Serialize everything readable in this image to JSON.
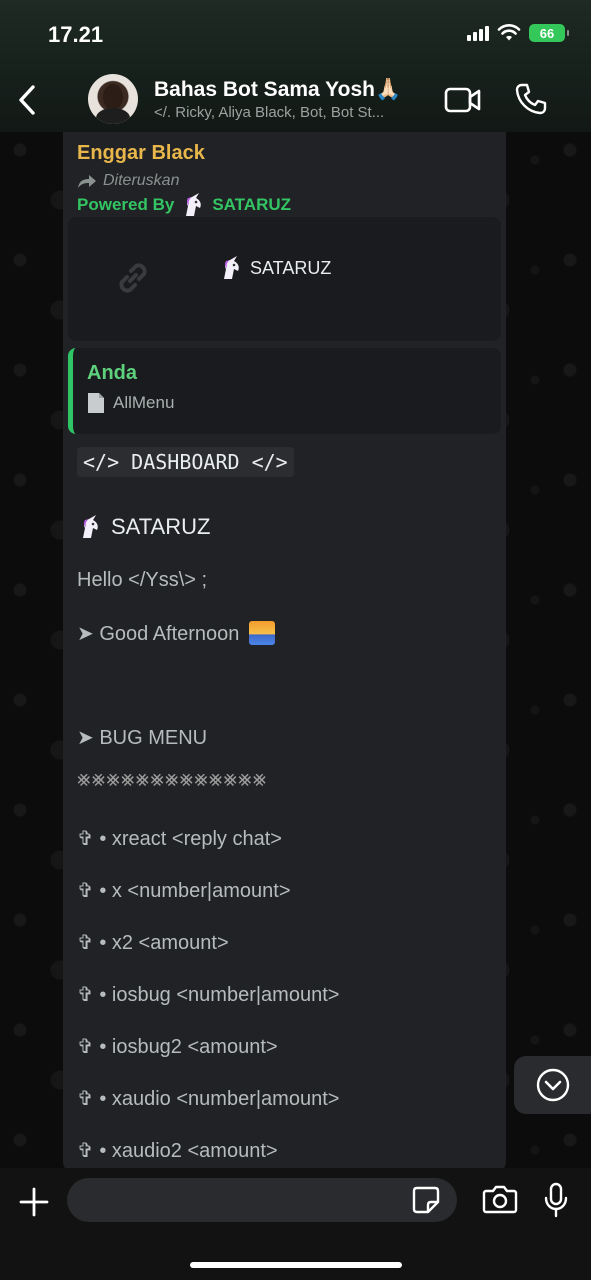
{
  "status_bar": {
    "time": "17.21",
    "battery": "66"
  },
  "header": {
    "title": "Bahas Bot Sama Yosh🙏🏻",
    "subtitle": "</. Ricky, Aliya Black, Bot, Bot St..."
  },
  "message": {
    "sender": "Enggar Black",
    "forwarded_label": "Diteruskan",
    "powered_by": "Powered By",
    "brand": "SATARUZ",
    "link_preview_title": "SATARUZ",
    "quote": {
      "author": "Anda",
      "text": "AllMenu"
    },
    "code_title": "</> DASHBOARD </>",
    "brand_line": "SATARUZ",
    "greeting": "Hello </Yss\\> ;",
    "time_greeting": "➤ Good Afternoon",
    "section_title": "➤ BUG MENU",
    "divider": "⨳⨳⨳⨳⨳⨳⨳⨳⨳⨳⨳⨳⨳",
    "commands": [
      "✞ • xreact <reply chat>",
      "✞ • x <number|amount>",
      "✞ • x2 <amount>",
      "✞ • iosbug <number|amount>",
      "✞ • iosbug2 <amount>",
      "✞ • xaudio <number|amount>",
      "✞ • xaudio2 <amount>"
    ]
  },
  "composer": {
    "value": "",
    "placeholder": ""
  },
  "icons": {
    "back": "chevron-left-icon",
    "video": "video-camera-icon",
    "call": "phone-icon",
    "scroll": "chevron-down-circle-icon",
    "plus": "plus-icon",
    "sticker": "sticker-icon",
    "camera": "camera-icon",
    "mic": "microphone-icon"
  },
  "colors": {
    "sender": "#e9b64b",
    "powered": "#33c463",
    "quote_bar": "#2fc565",
    "bubble": "#212225",
    "battery": "#34c759"
  }
}
